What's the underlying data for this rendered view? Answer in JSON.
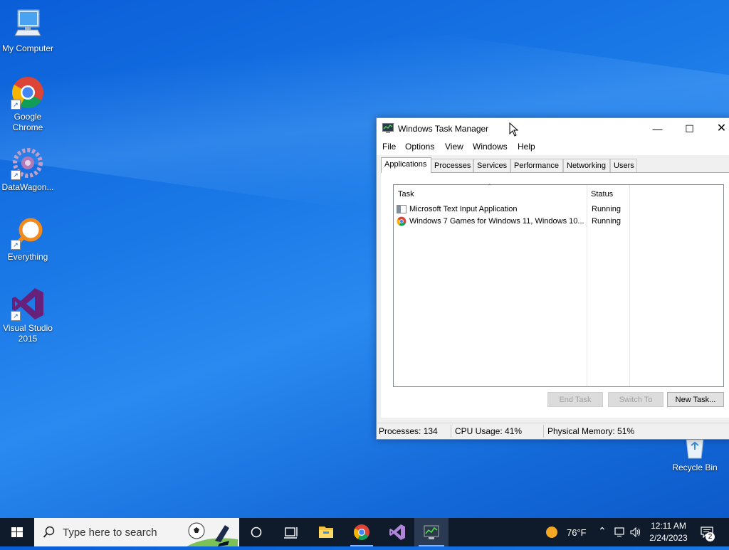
{
  "desktop": {
    "icons": [
      {
        "label": "My Computer"
      },
      {
        "label": "Google Chrome"
      },
      {
        "label": "DataWagon..."
      },
      {
        "label": "Everything"
      },
      {
        "label": "Visual Studio 2015"
      }
    ],
    "recycle_bin": "Recycle Bin"
  },
  "window": {
    "title": "Windows Task Manager",
    "menu": [
      "File",
      "Options",
      "View",
      "Windows",
      "Help"
    ],
    "tabs": [
      "Applications",
      "Processes",
      "Services",
      "Performance",
      "Networking",
      "Users"
    ],
    "active_tab": "Applications",
    "columns": {
      "task": "Task",
      "status": "Status"
    },
    "rows": [
      {
        "task": "Microsoft Text Input Application",
        "status": "Running",
        "icon": "window-app-icon"
      },
      {
        "task": "Windows 7 Games for Windows 11, Windows 10...",
        "status": "Running",
        "icon": "chrome-icon"
      }
    ],
    "buttons": {
      "end_task": "End Task",
      "switch_to": "Switch To",
      "new_task": "New Task..."
    },
    "status": {
      "processes": "Processes: 134",
      "cpu": "CPU Usage: 41%",
      "memory": "Physical Memory: 51%"
    }
  },
  "taskbar": {
    "search_placeholder": "Type here to search",
    "weather": "76°F",
    "time": "12:11 AM",
    "date": "2/24/2023",
    "notifications": "2"
  }
}
